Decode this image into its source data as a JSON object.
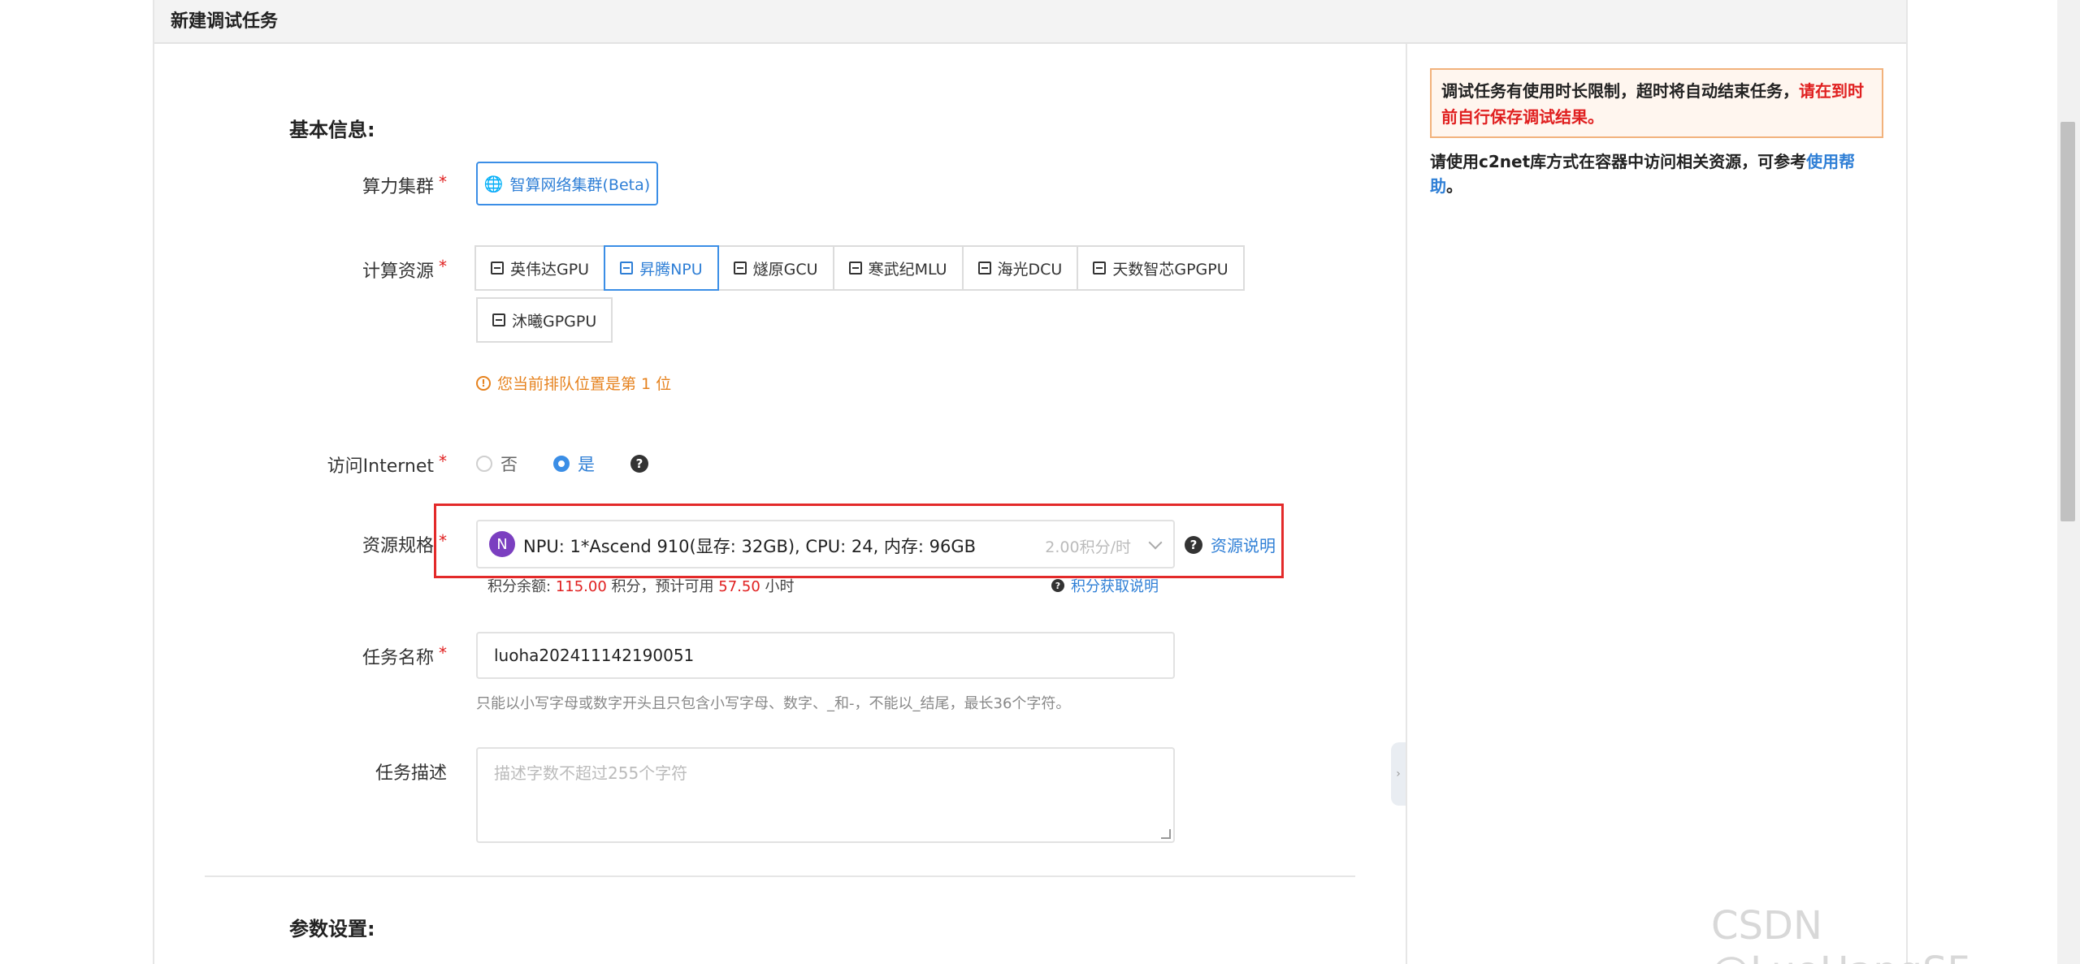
{
  "page": {
    "title": "新建调试任务"
  },
  "sections": {
    "basic": "基本信息:",
    "params": "参数设置:"
  },
  "form": {
    "cluster": {
      "label": "算力集群",
      "button": "智算网络集群(Beta)"
    },
    "compute": {
      "label": "计算资源",
      "tabs": [
        "英伟达GPU",
        "昇腾NPU",
        "燧原GCU",
        "寒武纪MLU",
        "海光DCU",
        "天数智芯GPGPU"
      ],
      "tab_row2": "沐曦GPGPU",
      "active": "昇腾NPU"
    },
    "queue": {
      "text": "您当前排队位置是第 1 位"
    },
    "internet": {
      "label": "访问Internet",
      "options": [
        "否",
        "是"
      ],
      "selected": "是"
    },
    "spec": {
      "label": "资源规格",
      "badge": "N",
      "value": "NPU: 1*Ascend 910(显存: 32GB), CPU: 24, 内存: 96GB",
      "price": "2.00积分/时",
      "help": "资源说明"
    },
    "balance": {
      "prefix": "积分余额:",
      "amount": "115.00",
      "middle": "积分，预计可用",
      "hours": "57.50",
      "suffix": "小时",
      "help": "积分获取说明"
    },
    "task_name": {
      "label": "任务名称",
      "value": "luoha202411142190051",
      "hint": "只能以小写字母或数字开头且只包含小写字母、数字、_和-，不能以_结尾，最长36个字符。"
    },
    "task_desc": {
      "label": "任务描述",
      "placeholder": "描述字数不超过255个字符"
    }
  },
  "sidebar": {
    "notice_black": "调试任务有使用时长限制，超时将自动结束任务，",
    "notice_red": "请在到时前自行保存调试结果。",
    "usage_prefix": "请使用c2net库方式在容器中访问相关资源，可参考",
    "usage_link": "使用帮助",
    "usage_suffix": "。"
  },
  "watermark": "CSDN @LuoHangSF",
  "colors": {
    "accent": "#3b8ee6",
    "highlight_box": "#e32a2a",
    "warning": "#e6821e",
    "badge": "#7b3fc0"
  }
}
